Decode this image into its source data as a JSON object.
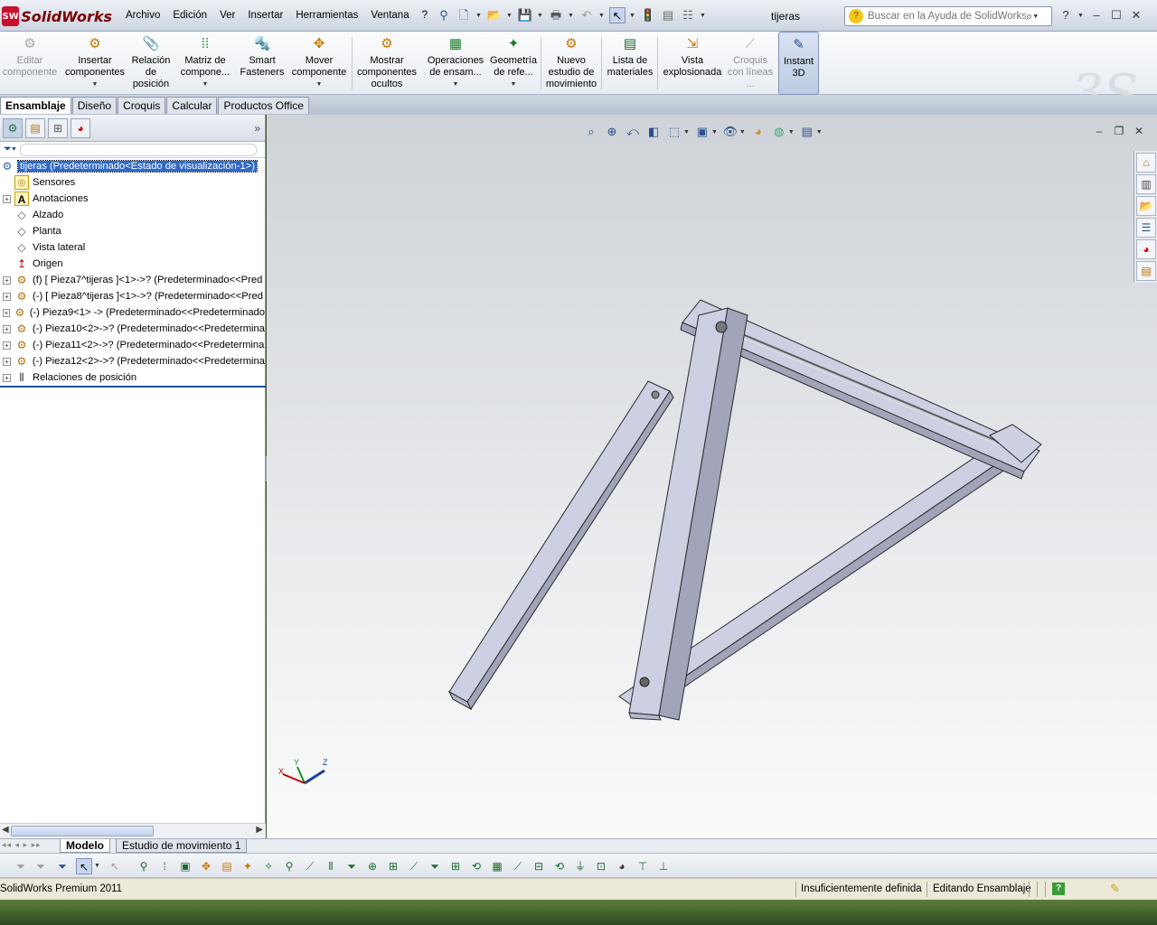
{
  "app": {
    "logo_mark": "SW",
    "logo_word": "SolidWorks",
    "doc_title": "tijeras"
  },
  "menu": [
    "Archivo",
    "Edición",
    "Ver",
    "Insertar",
    "Herramientas",
    "Ventana",
    "?"
  ],
  "search": {
    "placeholder": "Buscar en la Ayuda de SolidWorks"
  },
  "ribbon": [
    {
      "label": "Editar componente",
      "icon": "edit-component-icon",
      "disabled": true
    },
    {
      "label": "Insertar componentes",
      "icon": "insert-components-icon",
      "dropdown": true
    },
    {
      "label": "Relación de posición",
      "icon": "mate-icon"
    },
    {
      "label": "Matriz de compone...",
      "icon": "pattern-icon",
      "dropdown": true
    },
    {
      "label": "Smart Fasteners",
      "icon": "smart-fasteners-icon"
    },
    {
      "label": "Mover componente",
      "icon": "move-component-icon",
      "dropdown": true
    },
    {
      "label": "Mostrar componentes ocultos",
      "icon": "show-hidden-icon"
    },
    {
      "label": "Operaciones de ensam...",
      "icon": "assembly-features-icon",
      "dropdown": true
    },
    {
      "label": "Geometría de refe...",
      "icon": "reference-geometry-icon",
      "dropdown": true
    },
    {
      "label": "Nuevo estudio de movimiento",
      "icon": "motion-study-icon"
    },
    {
      "label": "Lista de materiales",
      "icon": "bom-icon"
    },
    {
      "label": "Vista explosionada",
      "icon": "exploded-view-icon"
    },
    {
      "label": "Croquis con líneas ...",
      "icon": "explode-line-sketch-icon",
      "disabled": true
    },
    {
      "label": "Instant 3D",
      "icon": "instant3d-icon",
      "active": true
    }
  ],
  "tabs": [
    "Ensamblaje",
    "Diseño",
    "Croquis",
    "Calcular",
    "Productos Office"
  ],
  "active_tab": "Ensamblaje",
  "tree": {
    "root": "tijeras  (Predeterminado<Estado de visualización-1>)",
    "items": [
      {
        "label": "Sensores",
        "icon": "sensor-icon",
        "expandable": false
      },
      {
        "label": "Anotaciones",
        "icon": "annotations-icon",
        "expandable": true
      },
      {
        "label": "Alzado",
        "icon": "plane-icon",
        "expandable": false
      },
      {
        "label": "Planta",
        "icon": "plane-icon",
        "expandable": false
      },
      {
        "label": "Vista lateral",
        "icon": "plane-icon",
        "expandable": false
      },
      {
        "label": "Origen",
        "icon": "origin-icon",
        "expandable": false
      },
      {
        "label": "(f) [ Pieza7^tijeras ]<1>->? (Predeterminado<<Pred",
        "icon": "part-icon",
        "expandable": true
      },
      {
        "label": "(-) [ Pieza8^tijeras ]<1>->? (Predeterminado<<Pred",
        "icon": "part-icon",
        "expandable": true
      },
      {
        "label": "(-) Pieza9<1> -> (Predeterminado<<Predeterminado",
        "icon": "part-icon",
        "expandable": true
      },
      {
        "label": "(-) Pieza10<2>->? (Predeterminado<<Predetermina",
        "icon": "part-icon",
        "expandable": true
      },
      {
        "label": "(-) Pieza11<2>->? (Predeterminado<<Predetermina",
        "icon": "part-icon",
        "expandable": true
      },
      {
        "label": "(-) Pieza12<2>->? (Predeterminado<<Predetermina",
        "icon": "part-icon",
        "expandable": true
      },
      {
        "label": "Relaciones de posición",
        "icon": "mates-icon",
        "expandable": true
      }
    ]
  },
  "bottom_tabs": [
    "Modelo",
    "Estudio de movimiento 1"
  ],
  "status": {
    "product": "SolidWorks Premium 2011",
    "definition": "Insuficientemente definida",
    "mode": "Editando Ensamblaje"
  },
  "triad_labels": {
    "x": "X",
    "y": "Y",
    "z": "Z"
  },
  "colors": {
    "part_face": "#c9cbe0",
    "part_edge": "#2a2a2a",
    "selection": "#316ac5",
    "ribbon_active": "#bccbe3"
  }
}
